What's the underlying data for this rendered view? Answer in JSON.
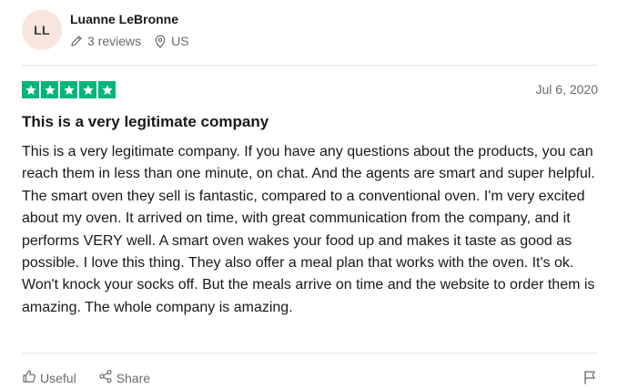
{
  "reviewer": {
    "initials": "LL",
    "name": "Luanne LeBronne",
    "reviews_count": "3 reviews",
    "country": "US",
    "icons": [
      "pencil-icon",
      "location-pin-icon"
    ]
  },
  "review": {
    "rating": 5,
    "rating_max": 5,
    "star_color": "#00b67a",
    "date": "Jul 6, 2020",
    "title": "This is a very legitimate company",
    "body": "This is a very legitimate company. If you have any questions about the products, you can reach them in less than one minute, on chat. And the agents are smart and super helpful. The smart oven they sell is fantastic, compared to a conventional oven. I'm very excited about my oven. It arrived on time, with great communication from the company, and it performs VERY well. A smart oven wakes your food up and makes it taste as good as possible. I love this thing. They also offer a meal plan that works with the oven. It's ok. Won't knock your socks off. But the meals arrive on time and the website to order them is amazing. The whole company is amazing."
  },
  "actions": {
    "useful_label": "Useful",
    "share_label": "Share",
    "icons": [
      "thumbs-up-icon",
      "share-icon",
      "flag-icon"
    ]
  }
}
